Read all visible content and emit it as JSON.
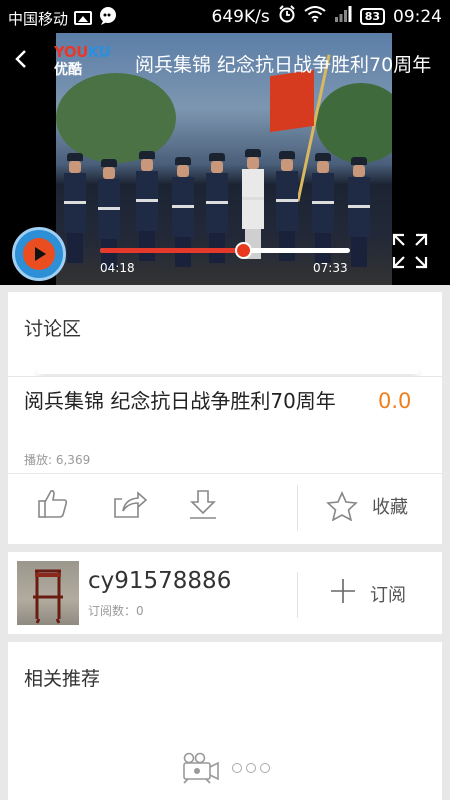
{
  "status_bar": {
    "carrier": "中国移动",
    "speed": "649K/s",
    "battery": "83",
    "time": "09:24",
    "icons": [
      "image-icon",
      "message-bubble-icon",
      "alarm-icon",
      "wifi-icon",
      "signal-icon",
      "battery-icon"
    ]
  },
  "player": {
    "logo_en_1": "YOU",
    "logo_en_2": "KU",
    "logo_cn": "优酷",
    "title": "阅兵集锦  纪念抗日战争胜利70周年",
    "current_time": "04:18",
    "total_time": "07:33",
    "progress": 0.57,
    "accent": "#e4392b"
  },
  "discussion": {
    "label": "讨论区"
  },
  "video_info": {
    "title": "阅兵集锦   纪念抗日战争胜利70周年",
    "score": "0.0",
    "plays": "播放: 6,369",
    "score_color": "#f07e1b",
    "actions": [
      "thumbs-up-icon",
      "share-icon",
      "download-icon"
    ],
    "favorite_label": "收藏"
  },
  "uploader": {
    "name": "cy91578886",
    "subscribers": "订阅数：0",
    "subscribe_label": "订阅"
  },
  "recommendations": {
    "label": "相关推荐"
  }
}
